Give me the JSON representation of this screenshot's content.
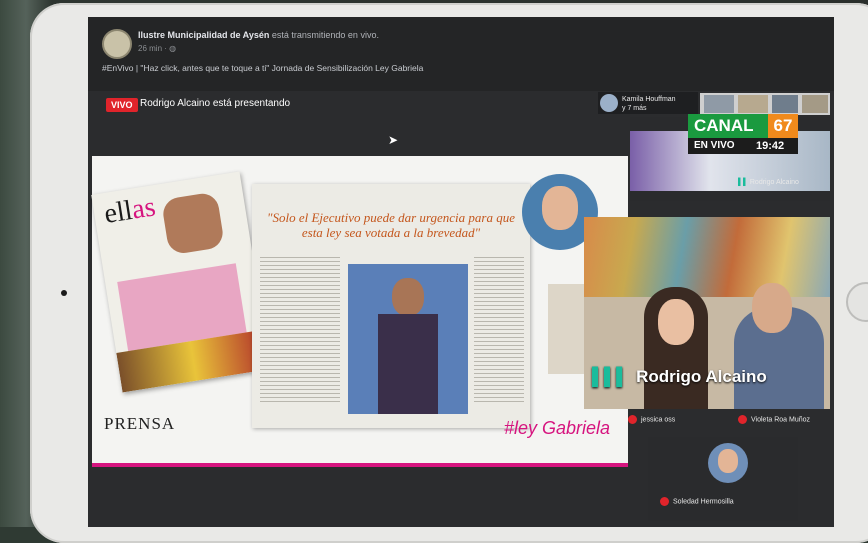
{
  "post": {
    "page_name": "Ilustre Municipalidad de Aysén",
    "action": "está transmitiendo en vivo.",
    "time": "26 min",
    "description": "#EnVivo | \"Haz click, antes que te toque a ti\" Jornada de Sensibilización Ley Gabriela"
  },
  "stream": {
    "live_badge": "VIVO",
    "presenter_text": "Rodrigo Alcaino está presentando"
  },
  "slide": {
    "magazine_title_a": "ell",
    "magazine_title_b": "as",
    "headline": "\"Solo el Ejecutivo puede dar urgencia para que esta ley sea votada a la brevedad\"",
    "footer_left": "PRENSA",
    "hashtag": "#ley Gabriela"
  },
  "participants": {
    "kamila_line1": "Kamila Houffman",
    "kamila_line2": "y 7 más",
    "rodrigo_small": "Rodrigo Alcaino",
    "rodrigo_big": "Rodrigo Alcaino",
    "jessica": "jessica oss",
    "violeta": "Violeta Roa Muñoz",
    "soledad": "Soledad Hermosilla"
  },
  "overlay": {
    "channel": "CANAL",
    "channel_number": "67",
    "en_vivo": "EN VIVO",
    "time": "19:42"
  },
  "colors": {
    "live_red": "#e0242b",
    "channel_green": "#1a9a3f",
    "channel_orange": "#f08a1c",
    "hashtag_pink": "#d6147f"
  }
}
